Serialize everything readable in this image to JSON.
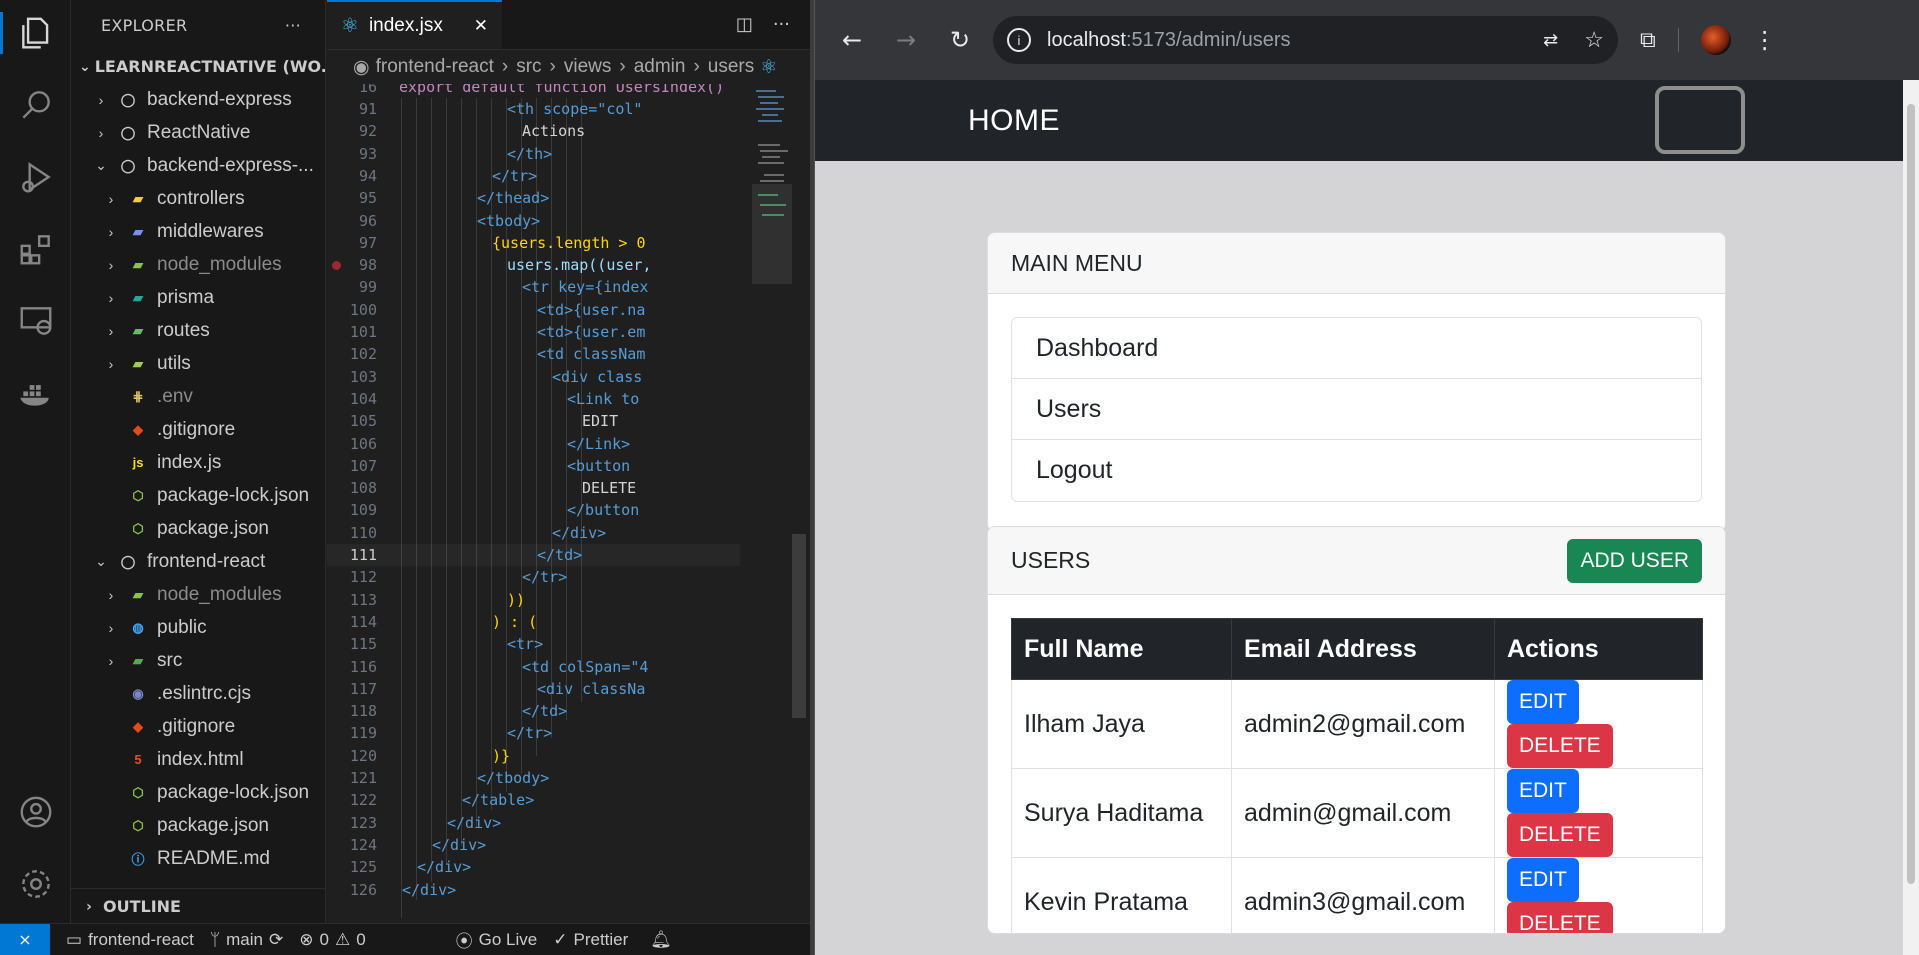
{
  "vscode": {
    "explorer_title": "EXPLORER",
    "explorer_more": "···",
    "workspace": "LEARNREACTNATIVE (WO...",
    "outline": "OUTLINE",
    "tree": [
      {
        "name": "backend-express",
        "chev": "›",
        "indent": 0,
        "icon": "folder-root-icon",
        "dim": false
      },
      {
        "name": "ReactNative",
        "chev": "›",
        "indent": 0,
        "icon": "folder-root-icon",
        "dim": false
      },
      {
        "name": "backend-express-...",
        "chev": "⌄",
        "indent": 0,
        "icon": "folder-root-icon",
        "dim": false
      },
      {
        "name": "controllers",
        "chev": "›",
        "indent": 1,
        "icon": "folder-controllers-icon",
        "dim": false
      },
      {
        "name": "middlewares",
        "chev": "›",
        "indent": 1,
        "icon": "folder-middlewares-icon",
        "dim": false
      },
      {
        "name": "node_modules",
        "chev": "›",
        "indent": 1,
        "icon": "folder-node-icon",
        "dim": true
      },
      {
        "name": "prisma",
        "chev": "›",
        "indent": 1,
        "icon": "folder-prisma-icon",
        "dim": false
      },
      {
        "name": "routes",
        "chev": "›",
        "indent": 1,
        "icon": "folder-routes-icon",
        "dim": false
      },
      {
        "name": "utils",
        "chev": "›",
        "indent": 1,
        "icon": "folder-utils-icon",
        "dim": false
      },
      {
        "name": ".env",
        "chev": "",
        "indent": 1,
        "icon": "env-file-icon",
        "dim": true
      },
      {
        "name": ".gitignore",
        "chev": "",
        "indent": 1,
        "icon": "git-file-icon",
        "dim": false
      },
      {
        "name": "index.js",
        "chev": "",
        "indent": 1,
        "icon": "js-file-icon",
        "dim": false
      },
      {
        "name": "package-lock.json",
        "chev": "",
        "indent": 1,
        "icon": "node-file-icon",
        "dim": false
      },
      {
        "name": "package.json",
        "chev": "",
        "indent": 1,
        "icon": "node-file-icon",
        "dim": false
      },
      {
        "name": "frontend-react",
        "chev": "⌄",
        "indent": 0,
        "icon": "folder-root-icon",
        "dim": false
      },
      {
        "name": "node_modules",
        "chev": "›",
        "indent": 1,
        "icon": "folder-node-icon",
        "dim": true
      },
      {
        "name": "public",
        "chev": "›",
        "indent": 1,
        "icon": "folder-public-icon",
        "dim": false
      },
      {
        "name": "src",
        "chev": "›",
        "indent": 1,
        "icon": "folder-src-icon",
        "dim": false
      },
      {
        "name": ".eslintrc.cjs",
        "chev": "",
        "indent": 1,
        "icon": "eslint-file-icon",
        "dim": false
      },
      {
        "name": ".gitignore",
        "chev": "",
        "indent": 1,
        "icon": "git-file-icon",
        "dim": false
      },
      {
        "name": "index.html",
        "chev": "",
        "indent": 1,
        "icon": "html-file-icon",
        "dim": false
      },
      {
        "name": "package-lock.json",
        "chev": "",
        "indent": 1,
        "icon": "node-file-icon",
        "dim": false
      },
      {
        "name": "package.json",
        "chev": "",
        "indent": 1,
        "icon": "node-file-icon",
        "dim": false
      },
      {
        "name": "README.md",
        "chev": "",
        "indent": 1,
        "icon": "info-file-icon",
        "dim": false
      }
    ],
    "tab": {
      "label": "index.jsx",
      "close": "✕"
    },
    "breadcrumb": [
      "frontend-react",
      "src",
      "views",
      "admin",
      "users"
    ],
    "sticky_line": {
      "number": "16",
      "text": "export default function UsersIndex()"
    },
    "code_lines": [
      {
        "n": "91",
        "text": "<th scope=\"col\"",
        "indent": 8
      },
      {
        "n": "92",
        "text": "Actions",
        "indent": 9
      },
      {
        "n": "93",
        "text": "</th>",
        "indent": 8
      },
      {
        "n": "94",
        "text": "</tr>",
        "indent": 7
      },
      {
        "n": "95",
        "text": "</thead>",
        "indent": 6
      },
      {
        "n": "96",
        "text": "<tbody>",
        "indent": 6
      },
      {
        "n": "97",
        "text": "{users.length > 0",
        "indent": 7
      },
      {
        "n": "98",
        "text": "users.map((user,",
        "indent": 8
      },
      {
        "n": "99",
        "text": "<tr key={index",
        "indent": 9
      },
      {
        "n": "100",
        "text": "<td>{user.na",
        "indent": 10
      },
      {
        "n": "101",
        "text": "<td>{user.em",
        "indent": 10
      },
      {
        "n": "102",
        "text": "<td classNam",
        "indent": 10
      },
      {
        "n": "103",
        "text": "<div class",
        "indent": 11
      },
      {
        "n": "104",
        "text": "<Link to",
        "indent": 12
      },
      {
        "n": "105",
        "text": "EDIT",
        "indent": 13
      },
      {
        "n": "106",
        "text": "</Link>",
        "indent": 12
      },
      {
        "n": "107",
        "text": "<button",
        "indent": 12
      },
      {
        "n": "108",
        "text": "DELETE",
        "indent": 13
      },
      {
        "n": "109",
        "text": "</button",
        "indent": 12
      },
      {
        "n": "110",
        "text": "</div>",
        "indent": 11
      },
      {
        "n": "111",
        "text": "</td>",
        "indent": 10
      },
      {
        "n": "112",
        "text": "</tr>",
        "indent": 9
      },
      {
        "n": "113",
        "text": "))",
        "indent": 8
      },
      {
        "n": "114",
        "text": ") : (",
        "indent": 7
      },
      {
        "n": "115",
        "text": "<tr>",
        "indent": 8
      },
      {
        "n": "116",
        "text": "<td colSpan=\"4",
        "indent": 9
      },
      {
        "n": "117",
        "text": "<div classNa",
        "indent": 10
      },
      {
        "n": "118",
        "text": "</td>",
        "indent": 9
      },
      {
        "n": "119",
        "text": "</tr>",
        "indent": 8
      },
      {
        "n": "120",
        "text": ")}",
        "indent": 7
      },
      {
        "n": "121",
        "text": "</tbody>",
        "indent": 6
      },
      {
        "n": "122",
        "text": "</table>",
        "indent": 5
      },
      {
        "n": "123",
        "text": "</div>",
        "indent": 4
      },
      {
        "n": "124",
        "text": "</div>",
        "indent": 3
      },
      {
        "n": "125",
        "text": "</div>",
        "indent": 2
      },
      {
        "n": "126",
        "text": "</div>",
        "indent": 1
      }
    ],
    "current_line": "111",
    "breakpoint_line": "98",
    "status": {
      "branch_folder": "frontend-react",
      "branch": "main",
      "errors": "0",
      "warnings": "0",
      "go_live": "Go Live",
      "prettier": "Prettier"
    }
  },
  "browser": {
    "url_host": "localhost",
    "url_rest": ":5173/admin/users",
    "navbar_brand": "HOME",
    "main_menu": {
      "title": "MAIN MENU",
      "items": [
        "Dashboard",
        "Users",
        "Logout"
      ]
    },
    "users_card": {
      "title": "USERS",
      "add_button": "ADD USER",
      "columns": [
        "Full Name",
        "Email Address",
        "Actions"
      ],
      "rows": [
        {
          "name": "Ilham Jaya",
          "email": "admin2@gmail.com"
        },
        {
          "name": "Surya Haditama",
          "email": "admin@gmail.com"
        },
        {
          "name": "Kevin Pratama",
          "email": "admin3@gmail.com"
        }
      ],
      "edit_label": "EDIT",
      "delete_label": "DELETE"
    }
  },
  "colors": {
    "vscode_accent": "#0078d4",
    "navbar_bg": "#212529",
    "add_button": "#198754",
    "edit_button": "#0d6efd",
    "delete_button": "#dc3545"
  }
}
